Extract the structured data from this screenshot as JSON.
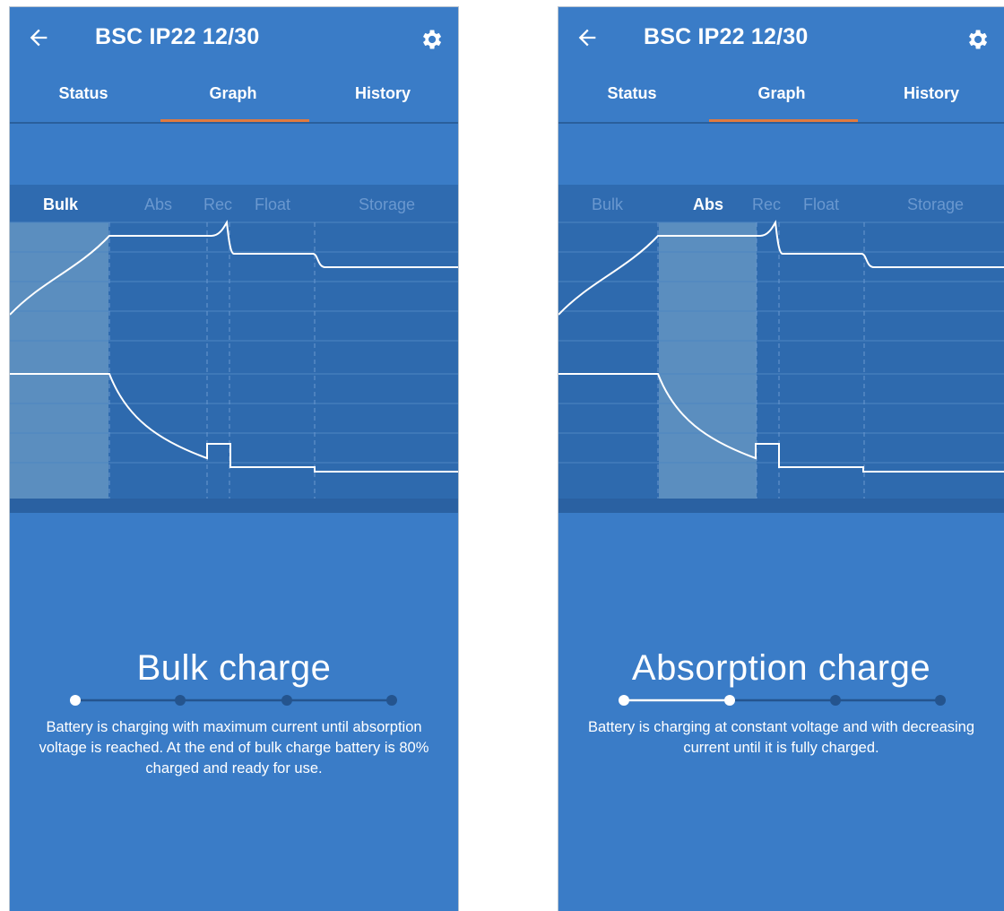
{
  "screens": [
    {
      "header": {
        "title": "BSC IP22 12/30"
      },
      "tabs": [
        "Status",
        "Graph",
        "History"
      ],
      "active_tab": "Graph",
      "stages": [
        "Bulk",
        "Abs",
        "Rec",
        "Float",
        "Storage"
      ],
      "active_stage": "Bulk",
      "charge_title": "Bulk charge",
      "description": "Battery is charging with maximum current until absorption voltage is reached. At the end of bulk charge battery is 80% charged and ready for use.",
      "progress": {
        "steps": 4,
        "current_step": 1
      }
    },
    {
      "header": {
        "title": "BSC IP22 12/30"
      },
      "tabs": [
        "Status",
        "Graph",
        "History"
      ],
      "active_tab": "Graph",
      "stages": [
        "Bulk",
        "Abs",
        "Rec",
        "Float",
        "Storage"
      ],
      "active_stage": "Abs",
      "charge_title": "Absorption charge",
      "description": "Battery is charging at constant voltage and with decreasing current until it is fully charged.",
      "progress": {
        "steps": 4,
        "current_step": 2
      }
    }
  ],
  "colors": {
    "background": "#3a7cc7",
    "graph_background": "#2e6aae",
    "tab_indicator": "#e07a3f",
    "inactive_stage_text": "#6a98cf",
    "active_text": "#ffffff"
  },
  "icons": [
    "back-arrow-icon",
    "gear-icon"
  ]
}
